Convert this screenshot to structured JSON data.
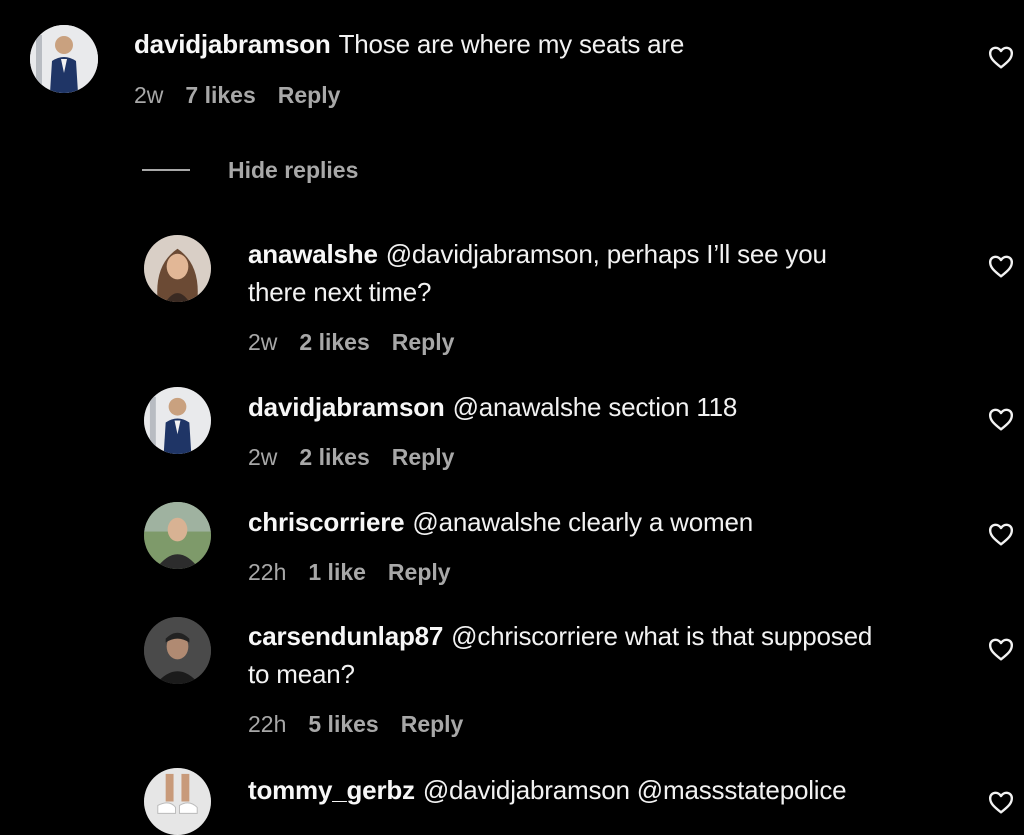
{
  "comments": [
    {
      "username": "davidjabramson",
      "text": "Those are where my seats are",
      "time": "2w",
      "likes": "7 likes",
      "reply": "Reply",
      "avatar": "man-in-suit-avatar"
    }
  ],
  "hide_replies": "Hide replies",
  "replies": [
    {
      "username": "anawalshe",
      "text": "@davidjabramson, perhaps I’ll see you",
      "text2": "there next time?",
      "time": "2w",
      "likes": "2 likes",
      "reply": "Reply",
      "avatar": "woman-portrait-avatar"
    },
    {
      "username": "davidjabramson",
      "text": "@anawalshe section 118",
      "time": "2w",
      "likes": "2 likes",
      "reply": "Reply",
      "avatar": "man-in-suit-avatar"
    },
    {
      "username": "chriscorriere",
      "text": "@anawalshe clearly a women",
      "time": "22h",
      "likes": "1 like",
      "reply": "Reply",
      "avatar": "man-outdoor-avatar"
    },
    {
      "username": "carsendunlap87",
      "text": "@chriscorriere what is that supposed",
      "text2": "to mean?",
      "time": "22h",
      "likes": "5 likes",
      "reply": "Reply",
      "avatar": "man-dark-avatar"
    },
    {
      "username": "tommy_gerbz",
      "text": "@davidjabramson @massstatepolice",
      "avatar": "person-sneakers-avatar"
    }
  ],
  "colors": {
    "background": "#000000",
    "text": "#f2f2f2",
    "meta": "#a8a8a8"
  },
  "icons": {
    "like": "heart-outline-icon"
  }
}
